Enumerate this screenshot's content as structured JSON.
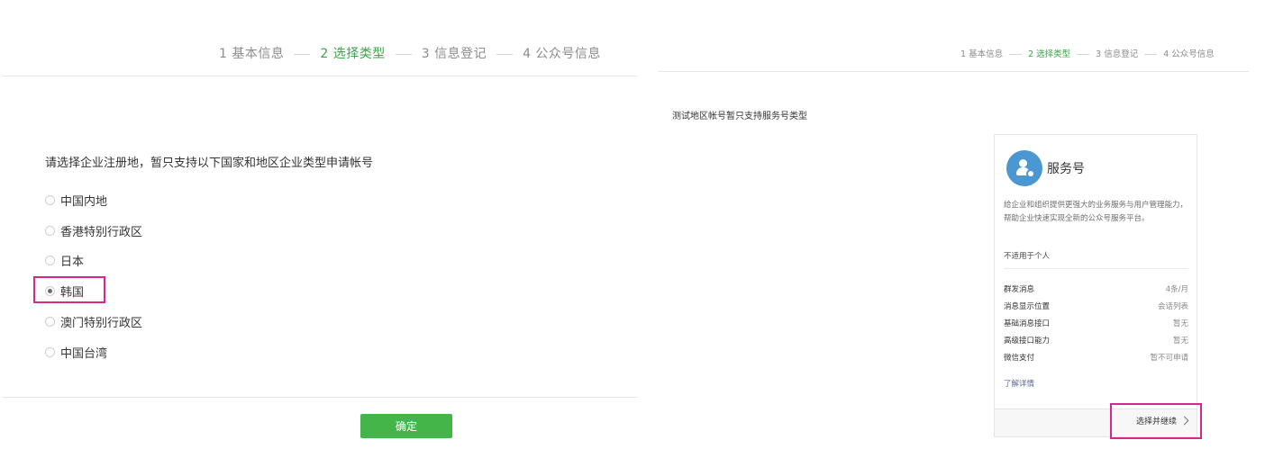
{
  "left": {
    "steps": [
      {
        "label": "1 基本信息",
        "active": false
      },
      {
        "label": "2 选择类型",
        "active": true
      },
      {
        "label": "3 信息登记",
        "active": false
      },
      {
        "label": "4 公众号信息",
        "active": false
      }
    ],
    "prompt": "请选择企业注册地，暂只支持以下国家和地区企业类型申请帐号",
    "options": [
      {
        "label": "中国内地",
        "checked": false
      },
      {
        "label": "香港特别行政区",
        "checked": false
      },
      {
        "label": "日本",
        "checked": false
      },
      {
        "label": "韩国",
        "checked": true
      },
      {
        "label": "澳门特别行政区",
        "checked": false
      },
      {
        "label": "中国台湾",
        "checked": false
      }
    ],
    "confirm_label": "确定"
  },
  "right": {
    "steps": [
      {
        "label": "1 基本信息",
        "active": false
      },
      {
        "label": "2 选择类型",
        "active": true
      },
      {
        "label": "3 信息登记",
        "active": false
      },
      {
        "label": "4 公众号信息",
        "active": false
      }
    ],
    "notice": "测试地区帐号暂只支持服务号类型",
    "card": {
      "icon": "service-account-icon",
      "title": "服务号",
      "description": "给企业和组织提供更强大的业务服务与用户管理能力，帮助企业快速实现全新的公众号服务平台。",
      "note": "不适用于个人",
      "features": [
        {
          "key": "群发消息",
          "value": "4条/月"
        },
        {
          "key": "消息显示位置",
          "value": "会话列表"
        },
        {
          "key": "基础消息接口",
          "value": "暂无"
        },
        {
          "key": "高级接口能力",
          "value": "暂无"
        },
        {
          "key": "微信支付",
          "value": "暂不可申请"
        }
      ],
      "learn_more": "了解详情",
      "continue_label": "选择并继续"
    }
  },
  "colors": {
    "active_step": "#3aa447",
    "primary_button": "#44b549",
    "highlight": "#d3298e",
    "icon_bg": "#4a97d2"
  }
}
